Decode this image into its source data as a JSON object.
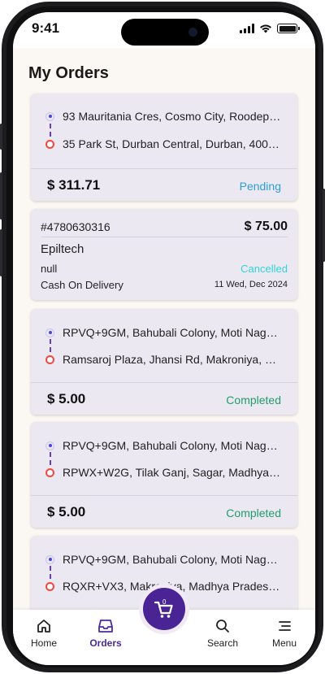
{
  "status_bar": {
    "time": "9:41"
  },
  "page": {
    "title": "My Orders"
  },
  "orders": [
    {
      "pickup": "93 Mauritania Cres, Cosmo City, Roodepoort...",
      "dropoff": "35 Park St, Durban Central, Durban, 4001, ...",
      "price": "$ 311.71",
      "status": "Pending",
      "status_color": "#2a9fd6"
    },
    {
      "order_id": "#4780630316",
      "price": "$ 75.00",
      "business": "Epiltech",
      "note": "null",
      "status": "Cancelled",
      "status_color": "#2fd3dc",
      "payment": "Cash On Delivery",
      "date": "11 Wed, Dec 2024"
    },
    {
      "pickup": "RPVQ+9GM, Bahubali Colony, Moti Nagar, ...",
      "dropoff": "Ramsaroj Plaza, Jhansi Rd, Makroniya, Raj...",
      "price": "$ 5.00",
      "status": "Completed",
      "status_color": "#1f9d6a"
    },
    {
      "pickup": "RPVQ+9GM, Bahubali Colony, Moti Nagar, ...",
      "dropoff": "RPWX+W2G, Tilak Ganj, Sagar, Madhya Pr...",
      "price": "$ 5.00",
      "status": "Completed",
      "status_color": "#1f9d6a"
    },
    {
      "pickup": "RPVQ+9GM, Bahubali Colony, Moti Nagar, ...",
      "dropoff": "RQXR+VX3, Makroniya, Madhya Pradesh 4..."
    }
  ],
  "tabbar": {
    "home": "Home",
    "orders": "Orders",
    "search": "Search",
    "menu": "Menu",
    "cart_count": "0",
    "active_color": "#4b2aa0"
  }
}
